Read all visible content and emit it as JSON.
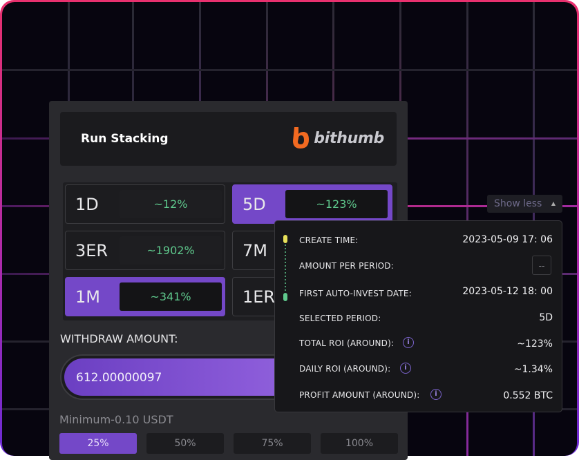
{
  "card": {
    "title": "Run Stacking",
    "brand": "bithumb",
    "periods": [
      {
        "label": "1D",
        "roi": "~12%"
      },
      {
        "label": "5D",
        "roi": "~123%"
      },
      {
        "label": "3ER",
        "roi": "~1902%"
      },
      {
        "label": "7M",
        "roi": ""
      },
      {
        "label": "1M",
        "roi": "~341%"
      },
      {
        "label": "1ER",
        "roi": ""
      }
    ],
    "withdraw_label": "WITHDRAW AMOUNT:",
    "withdraw_value": "612.00000097",
    "minimum": "Minimum-0.10 USDT",
    "percent_buttons": [
      "25%",
      "50%",
      "75%",
      "100%"
    ]
  },
  "show_less": "Show less",
  "details": {
    "create_time_label": "CREATE TIME:",
    "create_time": "2023-05-09 17: 06",
    "amount_per_period_label": "AMOUNT PER PERIOD:",
    "amount_per_period": "--",
    "first_auto_invest_label": "FIRST AUTO-INVEST DATE:",
    "first_auto_invest": "2023-05-12 18: 00",
    "selected_period_label": "SELECTED PERIOD:",
    "selected_period": "5D",
    "total_roi_label": "TOTAL ROI (AROUND):",
    "total_roi": "~123%",
    "daily_roi_label": "DAILY ROI (AROUND):",
    "daily_roi": "~1.34%",
    "profit_label": "PROFIT AMOUNT (AROUND):",
    "profit": "0.552 BTC"
  },
  "colors": {
    "accent": "#7448c8",
    "positive": "#5fc98d",
    "brand_orange": "#f26a21"
  }
}
